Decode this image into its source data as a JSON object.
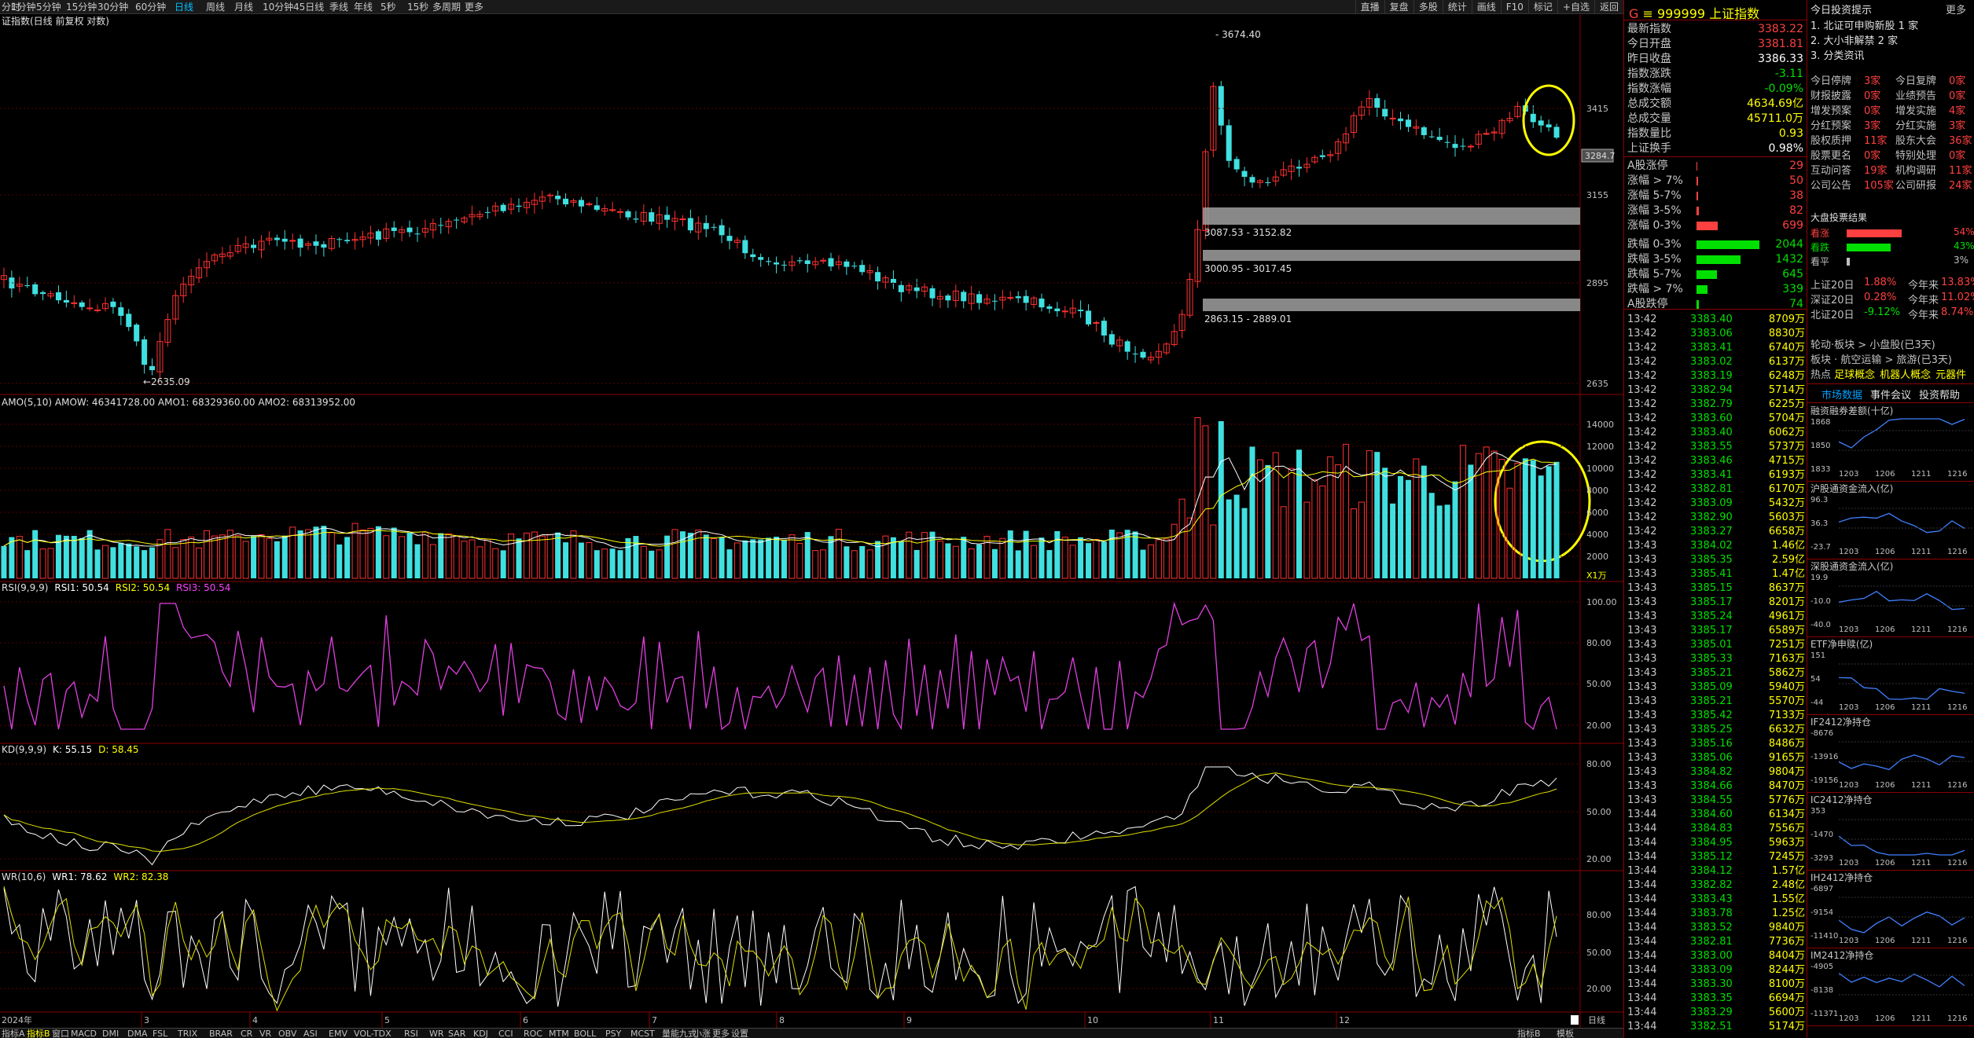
{
  "toolbar": {
    "items": [
      "分时",
      "1分钟",
      "5分钟",
      "15分钟",
      "30分钟",
      "60分钟",
      "日线",
      "周线",
      "月线",
      "10分钟",
      "45日线",
      "季线",
      "年线",
      "5秒",
      "15秒",
      "多周期",
      "更多"
    ],
    "active": "日线",
    "right": [
      "直播",
      "复盘",
      "多股",
      "统计",
      "画线",
      "F10",
      "标记",
      "+自选",
      "返回"
    ]
  },
  "main_chart": {
    "title": "证指数(日线 前复权 对数)",
    "price_labels": [
      "3415",
      "3155",
      "2895",
      "2635"
    ],
    "high_label": "3674.40",
    "low_label": "2635.09",
    "current": "3284.7",
    "zones": [
      "3087.53 - 3152.82",
      "3000.95 - 3017.45",
      "2863.15 - 2889.01"
    ]
  },
  "amo": {
    "header": "AMO(5,10)  AMOW: 46341728.00  AMO1: 68329360.00  AMO2: 68313952.00",
    "labels": [
      "14000",
      "12000",
      "10000",
      "8000",
      "6000",
      "4000",
      "2000"
    ],
    "unit": "X1万"
  },
  "rsi": {
    "header_parts": [
      "RSI(9,9,9)",
      "RSI1: 50.54",
      "RSI2: 50.54",
      "RSI3: 50.54"
    ],
    "labels": [
      "100.00",
      "80.00",
      "50.00",
      "20.00"
    ]
  },
  "kd": {
    "header_parts": [
      "KD(9,9,9)",
      "K: 55.15",
      "D: 58.45"
    ],
    "labels": [
      "80.00",
      "50.00",
      "20.00"
    ]
  },
  "wr": {
    "header_parts": [
      "WR(10,6)",
      "WR1: 78.62",
      "WR2: 82.38"
    ],
    "labels": [
      "80.00",
      "50.00",
      "20.00"
    ]
  },
  "x_axis": {
    "year": "2024年",
    "months": [
      "2",
      "3",
      "4",
      "5",
      "6",
      "7",
      "8",
      "9",
      "10",
      "11",
      "12"
    ]
  },
  "bottom_tabs": [
    "指标A",
    "指标B",
    "窗口",
    "MACD",
    "DMI",
    "DMA",
    "FSL",
    "TRIX",
    "BRAR",
    "CR",
    "VR",
    "OBV",
    "ASI",
    "EMV",
    "VOL-TDX",
    "RSI",
    "WR",
    "SAR",
    "KDJ",
    "CCI",
    "ROC",
    "MTM",
    "BOLL",
    "PSY",
    "MCST",
    "量能九式",
    "小涨",
    "更多",
    "设置"
  ],
  "bottom_right": [
    "指标B",
    "模板"
  ],
  "quote": {
    "code": "999999",
    "name": "上证指数",
    "prefix": "G",
    "rows": [
      {
        "label": "最新指数",
        "value": "3383.22",
        "cls": "up"
      },
      {
        "label": "今日开盘",
        "value": "3381.81",
        "cls": "up"
      },
      {
        "label": "昨日收盘",
        "value": "3386.33",
        "cls": "white"
      },
      {
        "label": "指数涨跌",
        "value": "-3.11",
        "cls": "down"
      },
      {
        "label": "指数涨幅",
        "value": "-0.09%",
        "cls": "down"
      },
      {
        "label": "总成交额",
        "value": "4634.69亿",
        "cls": "yellow"
      },
      {
        "label": "总成交量",
        "value": "45711.0万",
        "cls": "yellow"
      },
      {
        "label": "指数量比",
        "value": "0.93",
        "cls": "yellow"
      },
      {
        "label": "上证换手",
        "value": "0.98%",
        "cls": "white"
      }
    ],
    "dist": [
      {
        "label": "A股涨停",
        "value": "29",
        "cls": "up",
        "frac": 0.01
      },
      {
        "label": "涨幅 > 7%",
        "value": "50",
        "cls": "up",
        "frac": 0.02
      },
      {
        "label": "涨幅 5-7%",
        "value": "38",
        "cls": "up",
        "frac": 0.02
      },
      {
        "label": "涨幅 3-5%",
        "value": "82",
        "cls": "up",
        "frac": 0.04
      },
      {
        "label": "涨幅 0-3%",
        "value": "699",
        "cls": "up",
        "frac": 0.34
      },
      {
        "label": "跌幅 0-3%",
        "value": "2044",
        "cls": "down",
        "frac": 1.0
      },
      {
        "label": "跌幅 3-5%",
        "value": "1432",
        "cls": "down",
        "frac": 0.7
      },
      {
        "label": "跌幅 5-7%",
        "value": "645",
        "cls": "down",
        "frac": 0.32
      },
      {
        "label": "跌幅 > 7%",
        "value": "339",
        "cls": "down",
        "frac": 0.17
      },
      {
        "label": "A股跌停",
        "value": "74",
        "cls": "down",
        "frac": 0.04
      }
    ],
    "ticks": [
      [
        "13:42",
        "3383.40",
        "8709万"
      ],
      [
        "13:42",
        "3383.06",
        "8830万"
      ],
      [
        "13:42",
        "3383.41",
        "6740万"
      ],
      [
        "13:42",
        "3383.02",
        "6137万"
      ],
      [
        "13:42",
        "3383.19",
        "6248万"
      ],
      [
        "13:42",
        "3382.94",
        "5714万"
      ],
      [
        "13:42",
        "3382.79",
        "6225万"
      ],
      [
        "13:42",
        "3383.60",
        "5704万"
      ],
      [
        "13:42",
        "3383.40",
        "6062万"
      ],
      [
        "13:42",
        "3383.55",
        "5737万"
      ],
      [
        "13:42",
        "3383.46",
        "4715万"
      ],
      [
        "13:42",
        "3383.41",
        "6193万"
      ],
      [
        "13:42",
        "3382.81",
        "6170万"
      ],
      [
        "13:42",
        "3383.09",
        "5432万"
      ],
      [
        "13:42",
        "3382.90",
        "5603万"
      ],
      [
        "13:42",
        "3383.27",
        "6658万"
      ],
      [
        "13:43",
        "3384.02",
        "1.46亿"
      ],
      [
        "13:43",
        "3385.35",
        "2.59亿"
      ],
      [
        "13:43",
        "3385.41",
        "1.47亿"
      ],
      [
        "13:43",
        "3385.15",
        "8637万"
      ],
      [
        "13:43",
        "3385.17",
        "8201万"
      ],
      [
        "13:43",
        "3385.24",
        "4961万"
      ],
      [
        "13:43",
        "3385.17",
        "6589万"
      ],
      [
        "13:43",
        "3385.01",
        "7251万"
      ],
      [
        "13:43",
        "3385.33",
        "7163万"
      ],
      [
        "13:43",
        "3385.21",
        "5862万"
      ],
      [
        "13:43",
        "3385.09",
        "5940万"
      ],
      [
        "13:43",
        "3385.21",
        "5570万"
      ],
      [
        "13:43",
        "3385.42",
        "7133万"
      ],
      [
        "13:43",
        "3385.25",
        "6632万"
      ],
      [
        "13:43",
        "3385.16",
        "8486万"
      ],
      [
        "13:43",
        "3385.06",
        "9165万"
      ],
      [
        "13:43",
        "3384.82",
        "9804万"
      ],
      [
        "13:43",
        "3384.66",
        "8470万"
      ],
      [
        "13:43",
        "3384.55",
        "5776万"
      ],
      [
        "13:44",
        "3384.60",
        "6134万"
      ],
      [
        "13:44",
        "3384.83",
        "7556万"
      ],
      [
        "13:44",
        "3384.95",
        "5963万"
      ],
      [
        "13:44",
        "3385.12",
        "7245万"
      ],
      [
        "13:44",
        "3384.12",
        "1.57亿"
      ],
      [
        "13:44",
        "3382.82",
        "2.48亿"
      ],
      [
        "13:44",
        "3383.43",
        "1.55亿"
      ],
      [
        "13:44",
        "3383.78",
        "1.25亿"
      ],
      [
        "13:44",
        "3383.52",
        "9840万"
      ],
      [
        "13:44",
        "3382.81",
        "7736万"
      ],
      [
        "13:44",
        "3383.00",
        "8404万"
      ],
      [
        "13:44",
        "3383.09",
        "8244万"
      ],
      [
        "13:44",
        "3383.30",
        "8100万"
      ],
      [
        "13:44",
        "3383.35",
        "6694万"
      ],
      [
        "13:44",
        "3383.29",
        "5600万"
      ],
      [
        "13:44",
        "3382.51",
        "5174万"
      ]
    ]
  },
  "tips": {
    "title": "今日投资提示",
    "more": "更多",
    "items": [
      "1. 北证可申购新股 1 家",
      "2. 大小非解禁 2 家",
      "3. 分类资讯"
    ],
    "grid": [
      [
        "今日停牌",
        "3家",
        "今日复牌",
        "0家"
      ],
      [
        "财报披露",
        "0家",
        "业绩预告",
        "0家"
      ],
      [
        "增发预案",
        "0家",
        "增发实施",
        "4家"
      ],
      [
        "分红预案",
        "3家",
        "分红实施",
        "3家"
      ],
      [
        "股权质押",
        "11家",
        "股东大会",
        "36家"
      ],
      [
        "股票更名",
        "0家",
        "特别处理",
        "0家"
      ],
      [
        "互动问答",
        "19家",
        "机构调研",
        "11家"
      ],
      [
        "公司公告",
        "105家",
        "公司研报",
        "24家"
      ]
    ],
    "vote_title": "大盘投票结果",
    "votes": [
      [
        "看涨",
        "54%",
        0.54
      ],
      [
        "看跌",
        "43%",
        0.43
      ],
      [
        "看平",
        "3%",
        0.03
      ]
    ],
    "flows": [
      [
        "上证20日",
        "1.88%",
        "今年来",
        "13.83%"
      ],
      [
        "深证20日",
        "0.28%",
        "今年来",
        "11.02%"
      ],
      [
        "北证20日",
        "-9.12%",
        "今年来",
        "8.74%"
      ]
    ],
    "rotation": [
      "轮动·板块 > 小盘股(已3天)",
      "板块 · 航空运输 > 旅游(已3天)"
    ],
    "hot_label": "热点",
    "hot": [
      "足球概念",
      "机器人概念",
      "元器件"
    ],
    "tabs": [
      "市场数据",
      "事件会议",
      "投资帮助"
    ],
    "minis": [
      {
        "title": "融资融券差额(十亿)",
        "ticks": [
          "1868",
          "1850",
          "1833"
        ]
      },
      {
        "title": "沪股通资金流入(亿)",
        "ticks": [
          "96.3",
          "36.3",
          "-23.7"
        ]
      },
      {
        "title": "深股通资金流入(亿)",
        "ticks": [
          "19.9",
          "-10.0",
          "-40.0"
        ]
      },
      {
        "title": "ETF净申赎(亿)",
        "ticks": [
          "151",
          "54",
          "-44"
        ]
      },
      {
        "title": "IF2412净持仓",
        "ticks": [
          "-8676",
          "-13916",
          "-19156"
        ]
      },
      {
        "title": "IC2412净持仓",
        "ticks": [
          "353",
          "-1470",
          "-3293"
        ]
      },
      {
        "title": "IH2412净持仓",
        "ticks": [
          "-6897",
          "-9154",
          "-11410"
        ]
      },
      {
        "title": "IM2412净持仓",
        "ticks": [
          "-4905",
          "-8138",
          "-11371"
        ]
      }
    ],
    "mini_dates": [
      "1203",
      "1206",
      "1211",
      "1216"
    ]
  }
}
